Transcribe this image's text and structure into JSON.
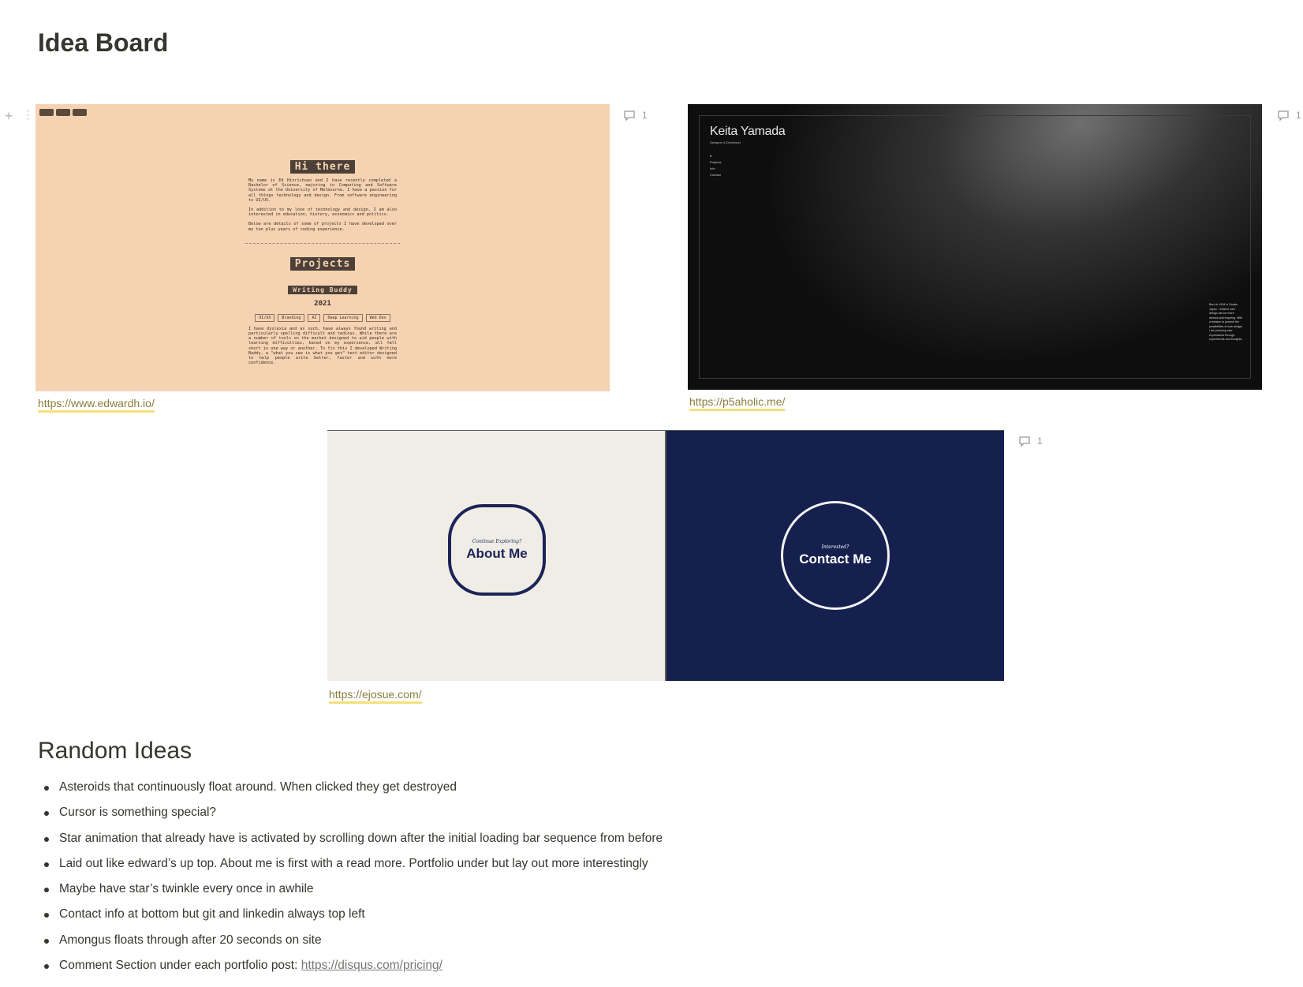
{
  "page": {
    "title": "Idea Board"
  },
  "gallery": [
    {
      "id": "edwardh",
      "link": "https://www.edwardh.io/",
      "comments": "1",
      "preview": {
        "heading": "Hi there",
        "intro_p1": "My name is Ed Hinrichsen and I have recently completed a Bachelor of Science, majoring in Computing and Software Systems at the University of Melbourne. I have a passion for all things technology and design. From software engineering to UI/UX.",
        "intro_p2": "In addition to my love of technology and design, I am also interested in education, history, economics and politics.",
        "intro_p3": "Below are details of some of projects I have developed over my ten plus years of coding experience.",
        "projects_heading": "Projects",
        "project_name": "Writing Buddy",
        "project_year": "2021",
        "tags": [
          "UI/UX",
          "Branding",
          "AI",
          "Deep Learning",
          "Web Dev"
        ],
        "project_desc": "I have dyslexia and as such, have always found writing and particularly spelling difficult and tedious. While there are a number of tools on the market designed to aid people with learning difficulties, based on my experience, all fall short in one way or another. To fix this I developed Writing Buddy, a \"what you see is what you get\" text editor designed to help people write better, faster and with more confidence."
      }
    },
    {
      "id": "p5aholic",
      "link": "https://p5aholic.me/",
      "comments": "1",
      "preview": {
        "name": "Keita Yamada",
        "subtitle": "Designer & Developer",
        "nav": [
          "●",
          "Projects",
          "Info",
          "Contact"
        ],
        "bio": "Born in 1994 in Osaka, Japan. I believe web design can be more diverse and inspiring. With a mission to present the possibilities of web design, I am pursuing new expressions through experiments and thoughts."
      }
    },
    {
      "id": "ejosue",
      "link": "https://ejosue.com/",
      "comments": "1",
      "preview": {
        "left_small": "Continue Exploring?",
        "left_big": "About Me",
        "right_small": "Interested?",
        "right_big": "Contact Me"
      }
    }
  ],
  "random_ideas": {
    "heading": "Random Ideas",
    "items": [
      "Asteroids that continuously float around. When clicked they get destroyed",
      "Cursor is something special?",
      "Star animation that already have is activated by scrolling down after the initial loading bar sequence from before",
      "Laid out like edward’s up top. About me is first with a read more. Portfolio under but lay out more interestingly",
      "Maybe have star’s twinkle every once in awhile",
      "Contact info at bottom but git and linkedin always top left",
      "Amongus floats through after 20 seconds on site",
      "Comment Section under each portfolio post: "
    ],
    "last_item_link": "https://disqus.com/pricing/"
  },
  "colors": {
    "text": "#37352f",
    "link_underline": "#f5e07a",
    "ejosue_navy": "#16204f",
    "edwardh_bg": "#f5d3b2"
  }
}
